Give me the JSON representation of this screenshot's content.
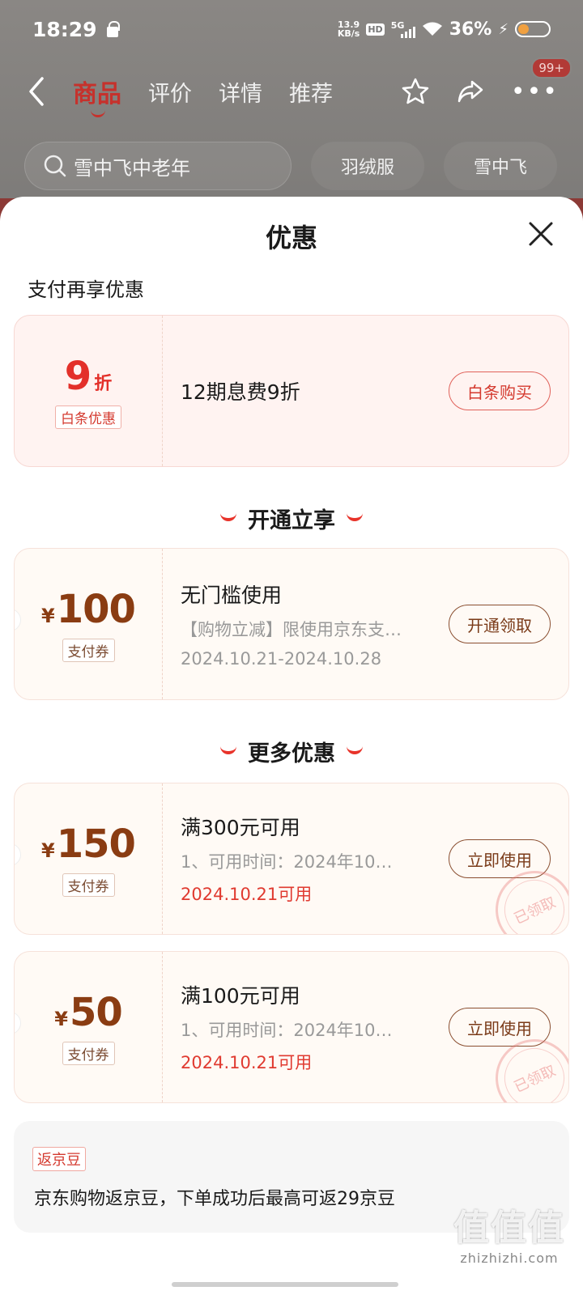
{
  "status_bar": {
    "time": "18:29",
    "net_speed_value": "13.9",
    "net_speed_unit": "KB/s",
    "hd": "HD",
    "network": "5G",
    "battery_percent": "36%",
    "battery_level": 0.36
  },
  "nav": {
    "tabs": [
      "商品",
      "评价",
      "详情",
      "推荐"
    ],
    "active_tab": "商品",
    "message_badge": "99+"
  },
  "search": {
    "placeholder": "雪中飞中老年",
    "hot_words": [
      "羽绒服",
      "雪中飞"
    ]
  },
  "sheet": {
    "title": "优惠",
    "pay_section_label": "支付再享优惠",
    "baitiao": {
      "discount_value": "9",
      "discount_unit": "折",
      "tag": "白条优惠",
      "description": "12期息费9折",
      "button": "白条购买"
    },
    "open_section_title": "开通立享",
    "open_coupon": {
      "currency": "¥",
      "amount": "100",
      "tag": "支付券",
      "title": "无门槛使用",
      "subtitle": "【购物立减】限使用京东支…",
      "date": "2024.10.21-2024.10.28",
      "button": "开通领取"
    },
    "more_section_title": "更多优惠",
    "coupons": [
      {
        "currency": "¥",
        "amount": "150",
        "tag": "支付券",
        "title": "满300元可用",
        "subtitle": "1、可用时间：2024年10…",
        "date": "2024.10.21可用",
        "button": "立即使用",
        "stamp": "已领取"
      },
      {
        "currency": "¥",
        "amount": "50",
        "tag": "支付券",
        "title": "满100元可用",
        "subtitle": "1、可用时间：2024年10…",
        "date": "2024.10.21可用",
        "button": "立即使用",
        "stamp": "已领取"
      }
    ],
    "jd_bean": {
      "tag": "返京豆",
      "text": "京东购物返京豆，下单成功后最高可返29京豆"
    }
  },
  "watermark": {
    "logo": "值值值",
    "domain": "zhizhizhi.com"
  },
  "colors": {
    "accent_red": "#e3302a",
    "coupon_brown": "#8a3c12",
    "sheet_bg": "#ffffff"
  },
  "icons": [
    "back-icon",
    "star-icon",
    "share-icon",
    "more-icon",
    "search-icon",
    "close-icon",
    "wifi-icon",
    "lock-icon",
    "battery-icon"
  ]
}
